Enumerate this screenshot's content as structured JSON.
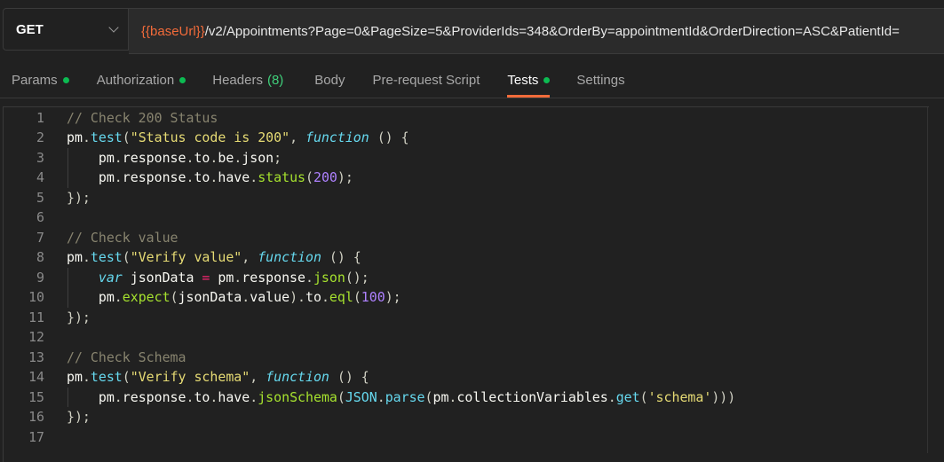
{
  "request": {
    "method": "GET",
    "url_variable": "{{baseUrl}}",
    "url_rest": "/v2/Appointments?Page=0&PageSize=5&ProviderIds=348&OrderBy=appointmentId&OrderDirection=ASC&PatientId="
  },
  "tabs": [
    {
      "label": "Params",
      "dot": true
    },
    {
      "label": "Authorization",
      "dot": true
    },
    {
      "label": "Headers",
      "count": "(8)"
    },
    {
      "label": "Body"
    },
    {
      "label": "Pre-request Script"
    },
    {
      "label": "Tests",
      "dot": true,
      "active": true
    },
    {
      "label": "Settings"
    }
  ],
  "colors": {
    "accent": "#f26b3a",
    "dot": "#0cbb52",
    "variable": "#f26b3a"
  },
  "editor": {
    "lines": [
      [
        [
          "comment",
          "// Check 200 Status"
        ]
      ],
      [
        [
          "id",
          "pm"
        ],
        [
          "punc",
          "."
        ],
        [
          "fn",
          "test"
        ],
        [
          "punc",
          "("
        ],
        [
          "str",
          "\"Status code is 200\""
        ],
        [
          "punc",
          ", "
        ],
        [
          "kw",
          "function"
        ],
        [
          "punc",
          " () {"
        ]
      ],
      [
        [
          "id",
          "    pm"
        ],
        [
          "punc",
          "."
        ],
        [
          "id",
          "response"
        ],
        [
          "punc",
          "."
        ],
        [
          "id",
          "to"
        ],
        [
          "punc",
          "."
        ],
        [
          "id",
          "be"
        ],
        [
          "punc",
          "."
        ],
        [
          "id",
          "json"
        ],
        [
          "punc",
          ";"
        ]
      ],
      [
        [
          "id",
          "    pm"
        ],
        [
          "punc",
          "."
        ],
        [
          "id",
          "response"
        ],
        [
          "punc",
          "."
        ],
        [
          "id",
          "to"
        ],
        [
          "punc",
          "."
        ],
        [
          "id",
          "have"
        ],
        [
          "punc",
          "."
        ],
        [
          "method",
          "status"
        ],
        [
          "punc",
          "("
        ],
        [
          "num",
          "200"
        ],
        [
          "punc",
          ");"
        ]
      ],
      [
        [
          "punc",
          "});"
        ]
      ],
      [],
      [
        [
          "comment",
          "// Check value"
        ]
      ],
      [
        [
          "id",
          "pm"
        ],
        [
          "punc",
          "."
        ],
        [
          "fn",
          "test"
        ],
        [
          "punc",
          "("
        ],
        [
          "str",
          "\"Verify value\""
        ],
        [
          "punc",
          ", "
        ],
        [
          "kw",
          "function"
        ],
        [
          "punc",
          " () {"
        ]
      ],
      [
        [
          "kw",
          "    var"
        ],
        [
          "id",
          " jsonData "
        ],
        [
          "op",
          "="
        ],
        [
          "id",
          " pm"
        ],
        [
          "punc",
          "."
        ],
        [
          "id",
          "response"
        ],
        [
          "punc",
          "."
        ],
        [
          "method",
          "json"
        ],
        [
          "punc",
          "();"
        ]
      ],
      [
        [
          "id",
          "    pm"
        ],
        [
          "punc",
          "."
        ],
        [
          "method",
          "expect"
        ],
        [
          "punc",
          "("
        ],
        [
          "id",
          "jsonData"
        ],
        [
          "punc",
          "."
        ],
        [
          "id",
          "value"
        ],
        [
          "punc",
          ")."
        ],
        [
          "id",
          "to"
        ],
        [
          "punc",
          "."
        ],
        [
          "method",
          "eql"
        ],
        [
          "punc",
          "("
        ],
        [
          "num",
          "100"
        ],
        [
          "punc",
          ");"
        ]
      ],
      [
        [
          "punc",
          "});"
        ]
      ],
      [],
      [
        [
          "comment",
          "// Check Schema"
        ]
      ],
      [
        [
          "id",
          "pm"
        ],
        [
          "punc",
          "."
        ],
        [
          "fn",
          "test"
        ],
        [
          "punc",
          "("
        ],
        [
          "str",
          "\"Verify schema\""
        ],
        [
          "punc",
          ", "
        ],
        [
          "kw",
          "function"
        ],
        [
          "punc",
          " () {"
        ]
      ],
      [
        [
          "id",
          "    pm"
        ],
        [
          "punc",
          "."
        ],
        [
          "id",
          "response"
        ],
        [
          "punc",
          "."
        ],
        [
          "id",
          "to"
        ],
        [
          "punc",
          "."
        ],
        [
          "id",
          "have"
        ],
        [
          "punc",
          "."
        ],
        [
          "method",
          "jsonSchema"
        ],
        [
          "punc",
          "("
        ],
        [
          "fn",
          "JSON"
        ],
        [
          "punc",
          "."
        ],
        [
          "fn",
          "parse"
        ],
        [
          "punc",
          "("
        ],
        [
          "id",
          "pm"
        ],
        [
          "punc",
          "."
        ],
        [
          "id",
          "collectionVariables"
        ],
        [
          "punc",
          "."
        ],
        [
          "fn",
          "get"
        ],
        [
          "punc",
          "("
        ],
        [
          "str",
          "'schema'"
        ],
        [
          "punc",
          ")))"
        ]
      ],
      [
        [
          "punc",
          "});"
        ]
      ],
      []
    ]
  }
}
